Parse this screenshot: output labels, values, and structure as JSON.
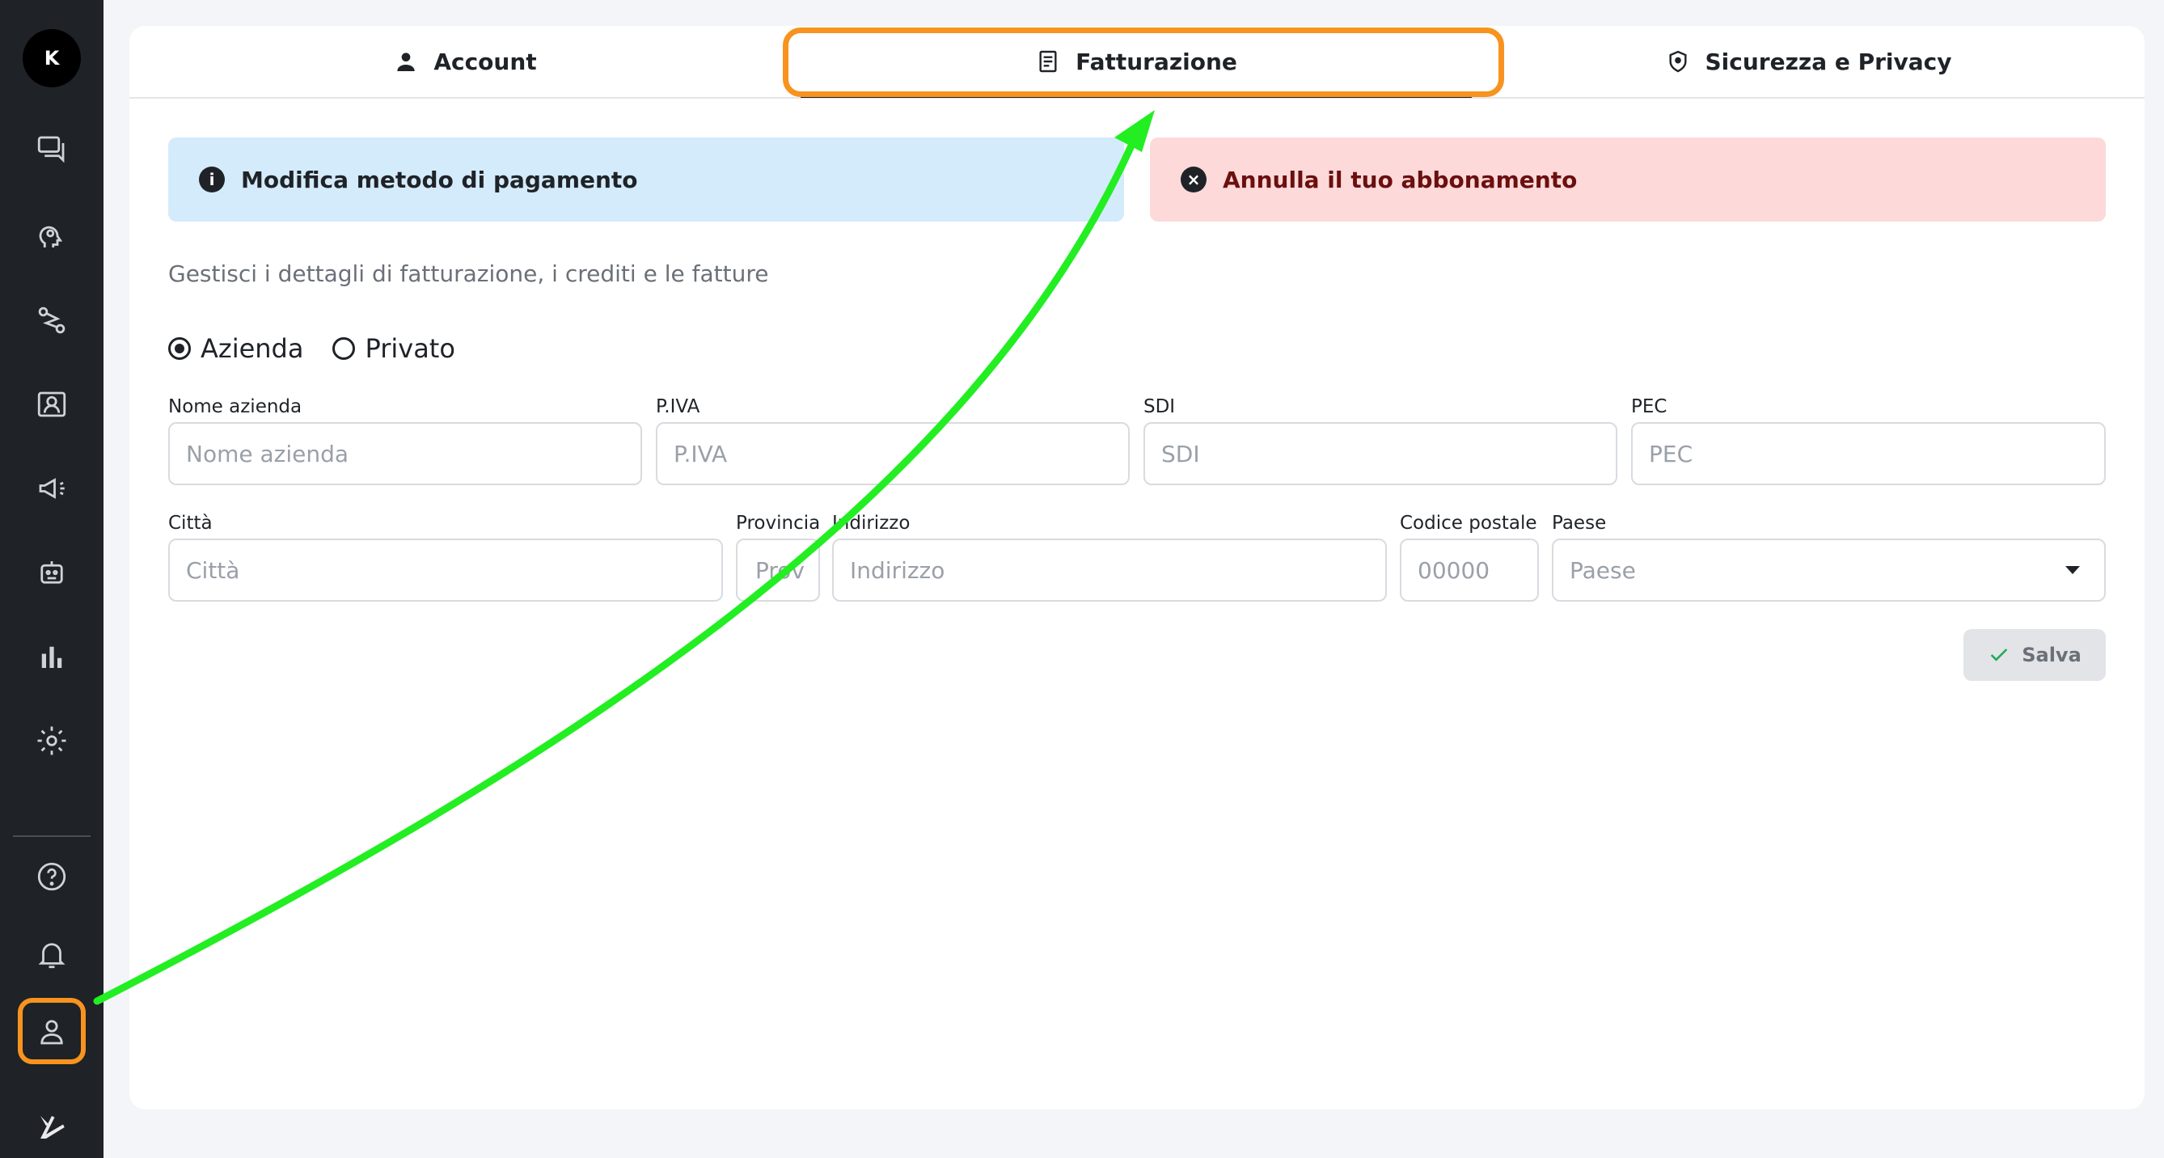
{
  "sidebar": {
    "avatar_initial": "K",
    "items": [
      {
        "icon": "chat-icon"
      },
      {
        "icon": "brain-icon"
      },
      {
        "icon": "workflow-icon"
      },
      {
        "icon": "contacts-icon"
      },
      {
        "icon": "megaphone-icon"
      },
      {
        "icon": "robot-icon"
      },
      {
        "icon": "chart-icon"
      },
      {
        "icon": "gear-icon"
      }
    ],
    "bottom_items": [
      {
        "icon": "help-icon"
      },
      {
        "icon": "bell-icon"
      },
      {
        "icon": "profile-icon"
      },
      {
        "icon": "logo-icon"
      }
    ]
  },
  "tabs": {
    "account": "Account",
    "billing": "Fatturazione",
    "security": "Sicurezza e Privacy"
  },
  "alerts": {
    "info": "Modifica metodo di pagamento",
    "info_icon": "i",
    "error": "Annulla il tuo abbonamento",
    "error_icon": "×"
  },
  "subtitle": "Gestisci i dettagli di fatturazione, i crediti e le fatture",
  "customer_type": {
    "options": [
      "Azienda",
      "Privato"
    ],
    "selected": "Azienda"
  },
  "fields": {
    "company_name": {
      "label": "Nome azienda",
      "placeholder": "Nome azienda"
    },
    "vat": {
      "label": "P.IVA",
      "placeholder": "P.IVA"
    },
    "sdi": {
      "label": "SDI",
      "placeholder": "SDI"
    },
    "pec": {
      "label": "PEC",
      "placeholder": "PEC"
    },
    "city": {
      "label": "Città",
      "placeholder": "Città"
    },
    "province": {
      "label": "Provincia",
      "placeholder": "Prov"
    },
    "address": {
      "label": "Indirizzo",
      "placeholder": "Indirizzo"
    },
    "postal_code": {
      "label": "Codice postale",
      "placeholder": "00000"
    },
    "country": {
      "label": "Paese",
      "placeholder": "Paese"
    }
  },
  "save_label": "Salva",
  "colors": {
    "highlight": "#f7931e",
    "arrow": "#22ee22",
    "info_bg": "#d4ebfb",
    "error_bg": "#fdd9d9"
  }
}
